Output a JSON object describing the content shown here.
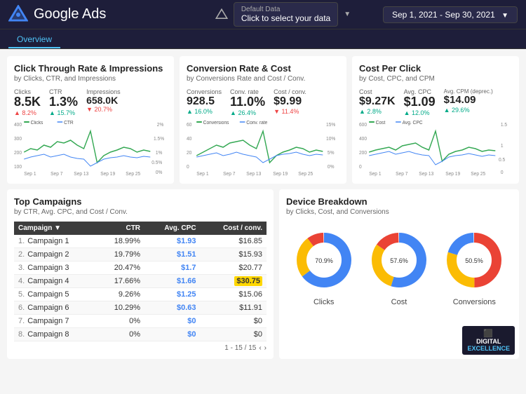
{
  "header": {
    "title": "Google Ads",
    "data_selector_label": "Default Data",
    "data_selector_sub": "Click to select your data",
    "date_range": "Sep 1, 2021 - Sep 30, 2021"
  },
  "tabs": [
    {
      "label": "Overview",
      "active": true
    }
  ],
  "metrics": [
    {
      "title": "Click Through Rate & Impressions",
      "subtitle": "by Clicks, CTR, and Impressions",
      "values": [
        {
          "label": "Clicks",
          "value": "8.5K",
          "change": "▲ 8.2%",
          "up": false
        },
        {
          "label": "CTR",
          "value": "1.3%",
          "change": "▲ 15.7%",
          "up": true
        },
        {
          "label": "Impressions",
          "value": "658.0K",
          "change": "▼ 20.7%",
          "up": false
        }
      ],
      "legend": [
        "Clicks",
        "CTR"
      ]
    },
    {
      "title": "Conversion Rate & Cost",
      "subtitle": "by Conversions Rate and Cost / Conv.",
      "values": [
        {
          "label": "Conversions",
          "value": "928.5",
          "change": "▲ 16.0%",
          "up": true
        },
        {
          "label": "Conv. rate",
          "value": "11.0%",
          "change": "▲ 26.4%",
          "up": true
        },
        {
          "label": "Cost / conv.",
          "value": "$9.99",
          "change": "▼ 11.4%",
          "up": false
        }
      ],
      "legend": [
        "Conversions",
        "Conv. rate"
      ]
    },
    {
      "title": "Cost Per Click",
      "subtitle": "by Cost, CPC, and CPM",
      "values": [
        {
          "label": "Cost",
          "value": "$9.27K",
          "change": "▲ 2.8%",
          "up": true
        },
        {
          "label": "Avg. CPC",
          "value": "$1.09",
          "change": "▲ 12.0%",
          "up": true
        },
        {
          "label": "Avg. CPM (deprec.)",
          "value": "$14.09",
          "change": "▲ 29.6%",
          "up": true
        }
      ],
      "legend": [
        "Cost",
        "Avg. CPC"
      ]
    }
  ],
  "campaigns": {
    "title": "Top Campaigns",
    "subtitle": "by CTR, Avg. CPC, and Cost / Conv.",
    "columns": [
      "Campaign ▼",
      "CTR",
      "Avg. CPC",
      "Cost / conv."
    ],
    "rows": [
      {
        "num": "1.",
        "name": "Campaign 1",
        "ctr": "18.99%",
        "cpc": "$1.93",
        "cost": "$16.85",
        "highlight": false
      },
      {
        "num": "2.",
        "name": "Campaign 2",
        "ctr": "19.79%",
        "cpc": "$1.51",
        "cost": "$15.93",
        "highlight": false
      },
      {
        "num": "3.",
        "name": "Campaign 3",
        "ctr": "20.47%",
        "cpc": "$1.7",
        "cost": "$20.77",
        "highlight": false
      },
      {
        "num": "4.",
        "name": "Campaign 4",
        "ctr": "17.66%",
        "cpc": "$1.66",
        "cost": "$30.75",
        "highlight": "yellow"
      },
      {
        "num": "5.",
        "name": "Campaign 5",
        "ctr": "9.26%",
        "cpc": "$1.25",
        "cost": "$15.06",
        "highlight": false
      },
      {
        "num": "6.",
        "name": "Campaign 6",
        "ctr": "10.29%",
        "cpc": "$0.63",
        "cost": "$11.91",
        "highlight": false
      },
      {
        "num": "7.",
        "name": "Campaign 7",
        "ctr": "0%",
        "cpc": "$0",
        "cost": "$0",
        "highlight": false
      },
      {
        "num": "8.",
        "name": "Campaign 8",
        "ctr": "0%",
        "cpc": "$0",
        "cost": "$0",
        "highlight": false
      }
    ],
    "pagination": "1 - 15 / 15"
  },
  "devices": {
    "title": "Device Breakdown",
    "subtitle": "by Clicks, Cost, and Conversions",
    "charts": [
      {
        "label": "Clicks",
        "segments": [
          {
            "pct": 65,
            "color": "#4285f4"
          },
          {
            "pct": 25,
            "color": "#fbbc04"
          },
          {
            "pct": 10,
            "color": "#ea4335"
          }
        ]
      },
      {
        "label": "Cost",
        "segments": [
          {
            "pct": 55,
            "color": "#4285f4"
          },
          {
            "pct": 30,
            "color": "#fbbc04"
          },
          {
            "pct": 15,
            "color": "#ea4335"
          }
        ]
      },
      {
        "label": "Conversions",
        "segments": [
          {
            "pct": 20,
            "color": "#4285f4"
          },
          {
            "pct": 30,
            "color": "#fbbc04"
          },
          {
            "pct": 50,
            "color": "#ea4335"
          }
        ]
      }
    ]
  },
  "watermark": {
    "line1": "DIGITAL",
    "line2": "EXCELLENCE"
  }
}
